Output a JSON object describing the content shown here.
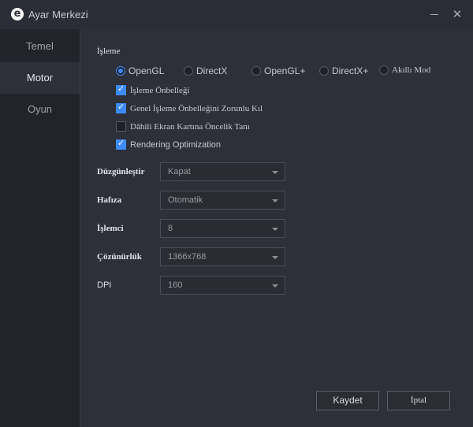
{
  "window": {
    "title": "Ayar Merkezi"
  },
  "sidebar": {
    "items": [
      {
        "label": "Temel"
      },
      {
        "label": "Motor"
      },
      {
        "label": "Oyun"
      }
    ]
  },
  "render": {
    "section_label": "İşleme",
    "options": [
      {
        "label": "OpenGL",
        "selected": true
      },
      {
        "label": "DirectX",
        "selected": false
      },
      {
        "label": "OpenGL+",
        "selected": false
      },
      {
        "label": "DirectX+",
        "selected": false
      },
      {
        "label": "Akıllı Mod",
        "selected": false
      }
    ],
    "checks": [
      {
        "label": "İşleme Önbelleği",
        "checked": true
      },
      {
        "label": "Genel İşleme Önbelleğini Zorunlu Kıl",
        "checked": true
      },
      {
        "label": "Dâhili Ekran Kartına Öncelik Tanı",
        "checked": false
      },
      {
        "label": "Rendering Optimization",
        "checked": true
      }
    ]
  },
  "fields": [
    {
      "label": "Düzgünleştir",
      "value": "Kapat"
    },
    {
      "label": "Hafıza",
      "value": "Otomatik"
    },
    {
      "label": "İşlemci",
      "value": "8"
    },
    {
      "label": "Çözünürlük",
      "value": "1366x768"
    },
    {
      "label": "DPI",
      "value": "160"
    }
  ],
  "buttons": {
    "save": "Kaydet",
    "cancel": "İptal"
  },
  "colors": {
    "accent": "#3d8bff",
    "background": "#2e3039",
    "sidebar": "#22242b"
  }
}
